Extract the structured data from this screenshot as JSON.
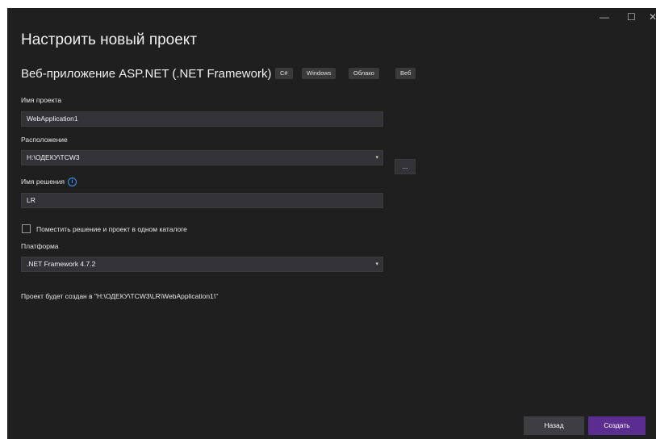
{
  "window": {
    "controls": {
      "minimize": "—",
      "maximize": "☐",
      "close": "✕"
    }
  },
  "header": {
    "title": "Настроить новый проект",
    "template_name": "Веб-приложение ASP.NET (.NET Framework)",
    "tags": [
      "C#",
      "Windows",
      "Облако",
      "Веб"
    ]
  },
  "form": {
    "project_name": {
      "label": "Имя проекта",
      "value": "WebApplication1"
    },
    "location": {
      "label": "Расположение",
      "value": "H:\\ОДЕКУ\\TCW3",
      "browse_label": "..."
    },
    "solution_name": {
      "label": "Имя решения",
      "value": "LR"
    },
    "same_folder": {
      "label": "Поместить решение и проект в одном каталоге",
      "checked": false
    },
    "platform": {
      "label": "Платформа",
      "value": ".NET Framework 4.7.2"
    },
    "output_path": "Проект будет создан в \"H:\\ОДЕКУ\\TCW3\\LR\\WebApplication1\\\""
  },
  "footer": {
    "back_label": "Назад",
    "create_label": "Создать"
  },
  "colors": {
    "background": "#1f1f1f",
    "accent": "#5c2d91",
    "info": "#3794ff"
  }
}
